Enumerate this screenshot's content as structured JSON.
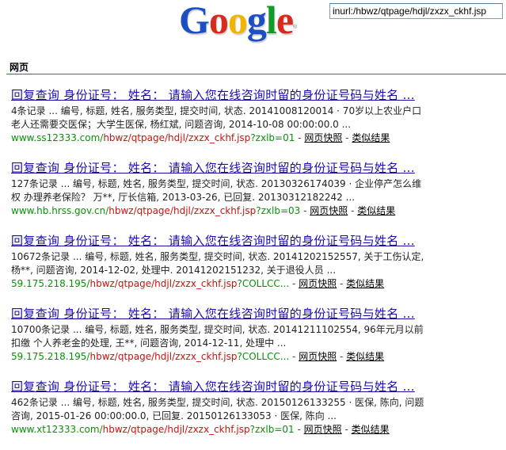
{
  "header": {
    "logo": [
      "G",
      "o",
      "o",
      "g",
      "l",
      "e"
    ],
    "logo_colors": [
      "#1c4fc3",
      "#d82a1e",
      "#f1b500",
      "#1c4fc3",
      "#109a28",
      "#d82a1e"
    ],
    "logo_tm": "®",
    "search_query": "inurl:/hbwz/qtpage/hdjl/zxzx_ckhf.jsp",
    "tab_web": "网页"
  },
  "results": [
    {
      "title": "回复查询 身份证号： 姓名： 请输入您在线咨询时留的身份证号码与姓名 ...",
      "snippet_1": "4条记录 ... 编号, 标题, 姓名, 服务类型, 提交时间, 状态. 20141008120014 · 70岁以上农业户口",
      "snippet_2": "老人还需要交医保；大学生医保, 杨红斌, 问题咨询, 2014-10-08 00:00:00.0 ...",
      "url_green": "www.ss12333.com/",
      "url_red": "hbwz/qtpage/hdjl/zxzx_ckhf.jsp",
      "url_tail": "?zxlb=01",
      "cached": "网页快照",
      "similar": "类似结果"
    },
    {
      "title": "回复查询 身份证号： 姓名： 请输入您在线咨询时留的身份证号码与姓名 ...",
      "snippet_1": "127条记录 ... 编号, 标题, 姓名, 服务类型, 提交时间, 状态. 20130326174039 · 企业停产怎么维",
      "snippet_2": "权 办理养老保险？ 万**, 厅长信箱, 2013-03-26, 已回复. 20130312182242 ...",
      "url_green": "www.hb.hrss.gov.cn/",
      "url_red": "hbwz/qtpage/hdjl/zxzx_ckhf.jsp",
      "url_tail": "?zxlb=03",
      "cached": "网页快照",
      "similar": "类似结果"
    },
    {
      "title": "回复查询 身份证号： 姓名： 请输入您在线咨询时留的身份证号码与姓名 ...",
      "snippet_1": "10672条记录 ... 编号, 标题, 姓名, 服务类型, 提交时间, 状态. 20141202152557, 关于工伤认定,",
      "snippet_2": "杨**, 问题咨询, 2014-12-02, 处理中. 20141202151232, 关于退役人员 ...",
      "url_green": "59.175.218.195/",
      "url_red": "hbwz/qtpage/hdjl/zxzx_ckhf.jsp",
      "url_tail": "?COLLCC...",
      "cached": "网页快照",
      "similar": "类似结果"
    },
    {
      "title": "回复查询 身份证号： 姓名： 请输入您在线咨询时留的身份证号码与姓名 ...",
      "snippet_1": "10700条记录 ... 编号, 标题, 姓名, 服务类型, 提交时间, 状态. 20141211102554, 96年元月以前",
      "snippet_2": "扣缴 个人养老金的处理, 王**, 问题咨询, 2014-12-11, 处理中 ...",
      "url_green": "59.175.218.195/",
      "url_red": "hbwz/qtpage/hdjl/zxzx_ckhf.jsp",
      "url_tail": "?COLLCC...",
      "cached": "网页快照",
      "similar": "类似结果"
    },
    {
      "title": "回复查询 身份证号： 姓名： 请输入您在线咨询时留的身份证号码与姓名 ...",
      "snippet_1": "462条记录 ... 编号, 标题, 姓名, 服务类型, 提交时间, 状态. 20150126133255 · 医保, 陈向, 问题",
      "snippet_2": "咨询, 2015-01-26 00:00:00.0, 已回复. 20150126133053 · 医保, 陈向 ...",
      "url_green": "www.xt12333.com/",
      "url_red": "hbwz/qtpage/hdjl/zxzx_ckhf.jsp",
      "url_tail": "?zxlb=01",
      "cached": "网页快照",
      "similar": "类似结果"
    }
  ],
  "separator": " - "
}
